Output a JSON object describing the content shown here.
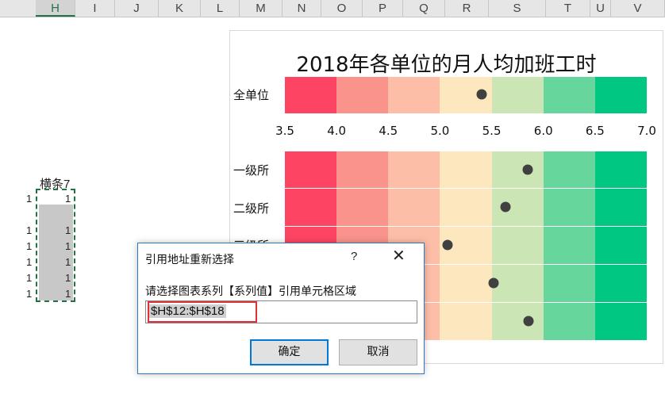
{
  "columns": [
    {
      "label": "H",
      "selected": true
    },
    {
      "label": "I",
      "selected": false
    },
    {
      "label": "J",
      "selected": false
    },
    {
      "label": "K",
      "selected": false
    },
    {
      "label": "L",
      "selected": false
    },
    {
      "label": "M",
      "selected": false
    },
    {
      "label": "N",
      "selected": false
    },
    {
      "label": "O",
      "selected": false
    },
    {
      "label": "P",
      "selected": false
    },
    {
      "label": "Q",
      "selected": false
    },
    {
      "label": "R",
      "selected": false
    },
    {
      "label": "S",
      "selected": false
    },
    {
      "label": "T",
      "selected": false
    },
    {
      "label": "U",
      "selected": false
    },
    {
      "label": "V",
      "selected": false
    }
  ],
  "sheet": {
    "header_text": "横条7",
    "col_g_values": [
      "1",
      "1",
      "1",
      "1",
      "1",
      "1"
    ],
    "col_h_values": [
      "1",
      "1",
      "1",
      "1",
      "1",
      "1"
    ]
  },
  "chart": {
    "title": "2018年各单位的月人均加班工时",
    "top_row_label": "全单位",
    "row_labels": [
      "一级所",
      "二级所",
      "三级所"
    ],
    "ticks": [
      "3.5",
      "4.0",
      "4.5",
      "5.0",
      "5.5",
      "6.0",
      "6.5",
      "7.0"
    ],
    "band_colors": [
      "#fd4563",
      "#fa938c",
      "#fdbea7",
      "#fde7bf",
      "#cce5b5",
      "#66d69c",
      "#00c782"
    ]
  },
  "chart_data": {
    "type": "scatter",
    "title": "2018年各单位的月人均加班工时",
    "xlim": [
      3.5,
      7.0
    ],
    "x_ticks": [
      3.5,
      4.0,
      4.5,
      5.0,
      5.5,
      6.0,
      6.5,
      7.0
    ],
    "band_edges": [
      3.5,
      4.0,
      4.5,
      5.0,
      5.5,
      6.0,
      6.5,
      7.0
    ],
    "summary": {
      "category": "全单位",
      "value": 5.4
    },
    "categories": [
      "一级所",
      "二级所",
      "三级所",
      "",
      ""
    ],
    "values": [
      5.85,
      5.63,
      5.07,
      5.52,
      5.86
    ]
  },
  "dialog": {
    "title": "引用地址重新选择",
    "help": "?",
    "close": "✕",
    "prompt": "请选择图表系列【系列值】引用单元格区域",
    "input_value": "$H$12:$H$18",
    "ok_label": "确定",
    "cancel_label": "取消"
  }
}
